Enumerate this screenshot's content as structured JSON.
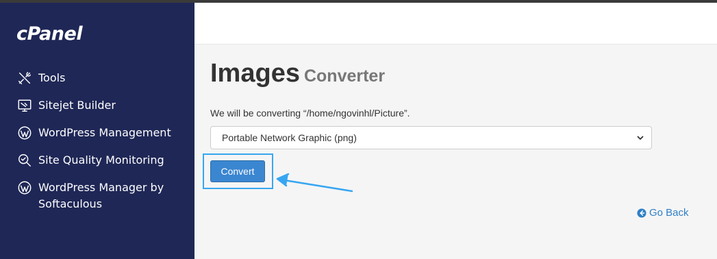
{
  "sidebar": {
    "logo": "cPanel",
    "items": [
      {
        "label": "Tools",
        "icon": "tools-icon"
      },
      {
        "label": "Sitejet Builder",
        "icon": "sitejet-icon"
      },
      {
        "label": "WordPress Management",
        "icon": "wordpress-icon"
      },
      {
        "label": "Site Quality Monitoring",
        "icon": "magnifier-icon"
      },
      {
        "label": "WordPress Manager by Softaculous",
        "icon": "wordpress-icon"
      }
    ]
  },
  "main": {
    "title": "Images",
    "subtitle": "Converter",
    "info": "We will be converting “/home/ngovinhl/Picture”.",
    "format_select": {
      "selected": "Portable Network Graphic (png)"
    },
    "convert_label": "Convert",
    "go_back_label": "Go Back"
  },
  "colors": {
    "sidebar_bg": "#1f2756",
    "button_bg": "#3b86d1",
    "highlight": "#36a6f2",
    "link": "#2f7fc6"
  }
}
